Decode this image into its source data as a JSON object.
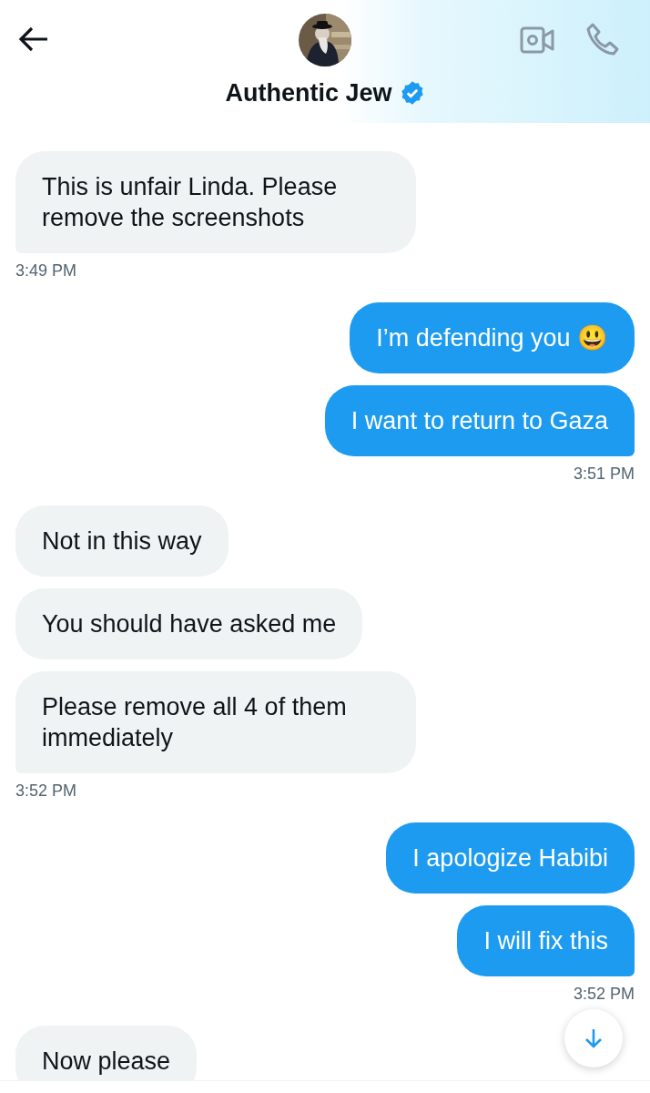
{
  "header": {
    "title": "Authentic Jew",
    "verified": true
  },
  "groups": [
    {
      "kind": "received",
      "bubbles": [
        "This is unfair Linda. Please remove the screenshots"
      ],
      "time": "3:49 PM"
    },
    {
      "kind": "sent",
      "bubbles": [
        "I’m defending you 😃",
        "I want to return to Gaza"
      ],
      "time": "3:51 PM"
    },
    {
      "kind": "received",
      "bubbles": [
        "Not in this way",
        "You should have asked me",
        "Please remove all 4 of them immediately"
      ],
      "time": "3:52 PM"
    },
    {
      "kind": "sent",
      "bubbles": [
        "I apologize Habibi",
        "I will fix this"
      ],
      "time": "3:52 PM"
    },
    {
      "kind": "received",
      "bubbles": [
        "Now please"
      ]
    }
  ]
}
